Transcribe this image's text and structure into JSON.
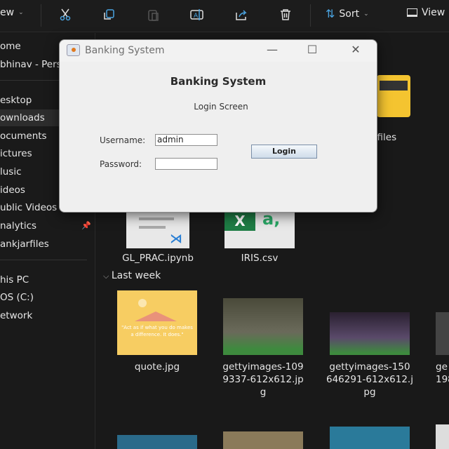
{
  "toolbar": {
    "new_label": "ew",
    "sort_label": "Sort",
    "view_label": "View",
    "icons": [
      "cut-icon",
      "copy-icon",
      "paste-icon",
      "rename-icon",
      "share-icon",
      "delete-icon",
      "sort-icon",
      "view-icon"
    ]
  },
  "sidebar": {
    "items": [
      {
        "label": "ome"
      },
      {
        "label": "bhinav - Pers"
      },
      {
        "label": "esktop"
      },
      {
        "label": "ownloads",
        "selected": true
      },
      {
        "label": "ocuments"
      },
      {
        "label": "ictures"
      },
      {
        "label": "lusic"
      },
      {
        "label": "ideos"
      },
      {
        "label": "ublic Videos"
      },
      {
        "label": "nalytics",
        "pinned": true
      },
      {
        "label": "ankjarfiles"
      },
      {
        "label": "his PC"
      },
      {
        "label": "OS (C:)"
      },
      {
        "label": "etwork"
      }
    ]
  },
  "content": {
    "partial_folder_label": "rfiles",
    "files_top": [
      {
        "name": "GL_PRAC.ipynb"
      },
      {
        "name": "IRIS.csv"
      }
    ],
    "section_last_week": "Last week",
    "files_last_week": [
      {
        "name": "quote.jpg"
      },
      {
        "name": "gettyimages-109 9337-612x612.jp g"
      },
      {
        "name": "gettyimages-150 646291-612x612.j pg"
      },
      {
        "name": "ge 198"
      }
    ],
    "quote_thumb_text": "\"Act as if what you do makes a difference. It does.\""
  },
  "dialog": {
    "window_title": "Banking System",
    "heading": "Banking System",
    "subtitle": "Login Screen",
    "username_label": "Username:",
    "username_value": "admin",
    "password_label": "Password:",
    "password_value": "",
    "login_button": "Login"
  }
}
